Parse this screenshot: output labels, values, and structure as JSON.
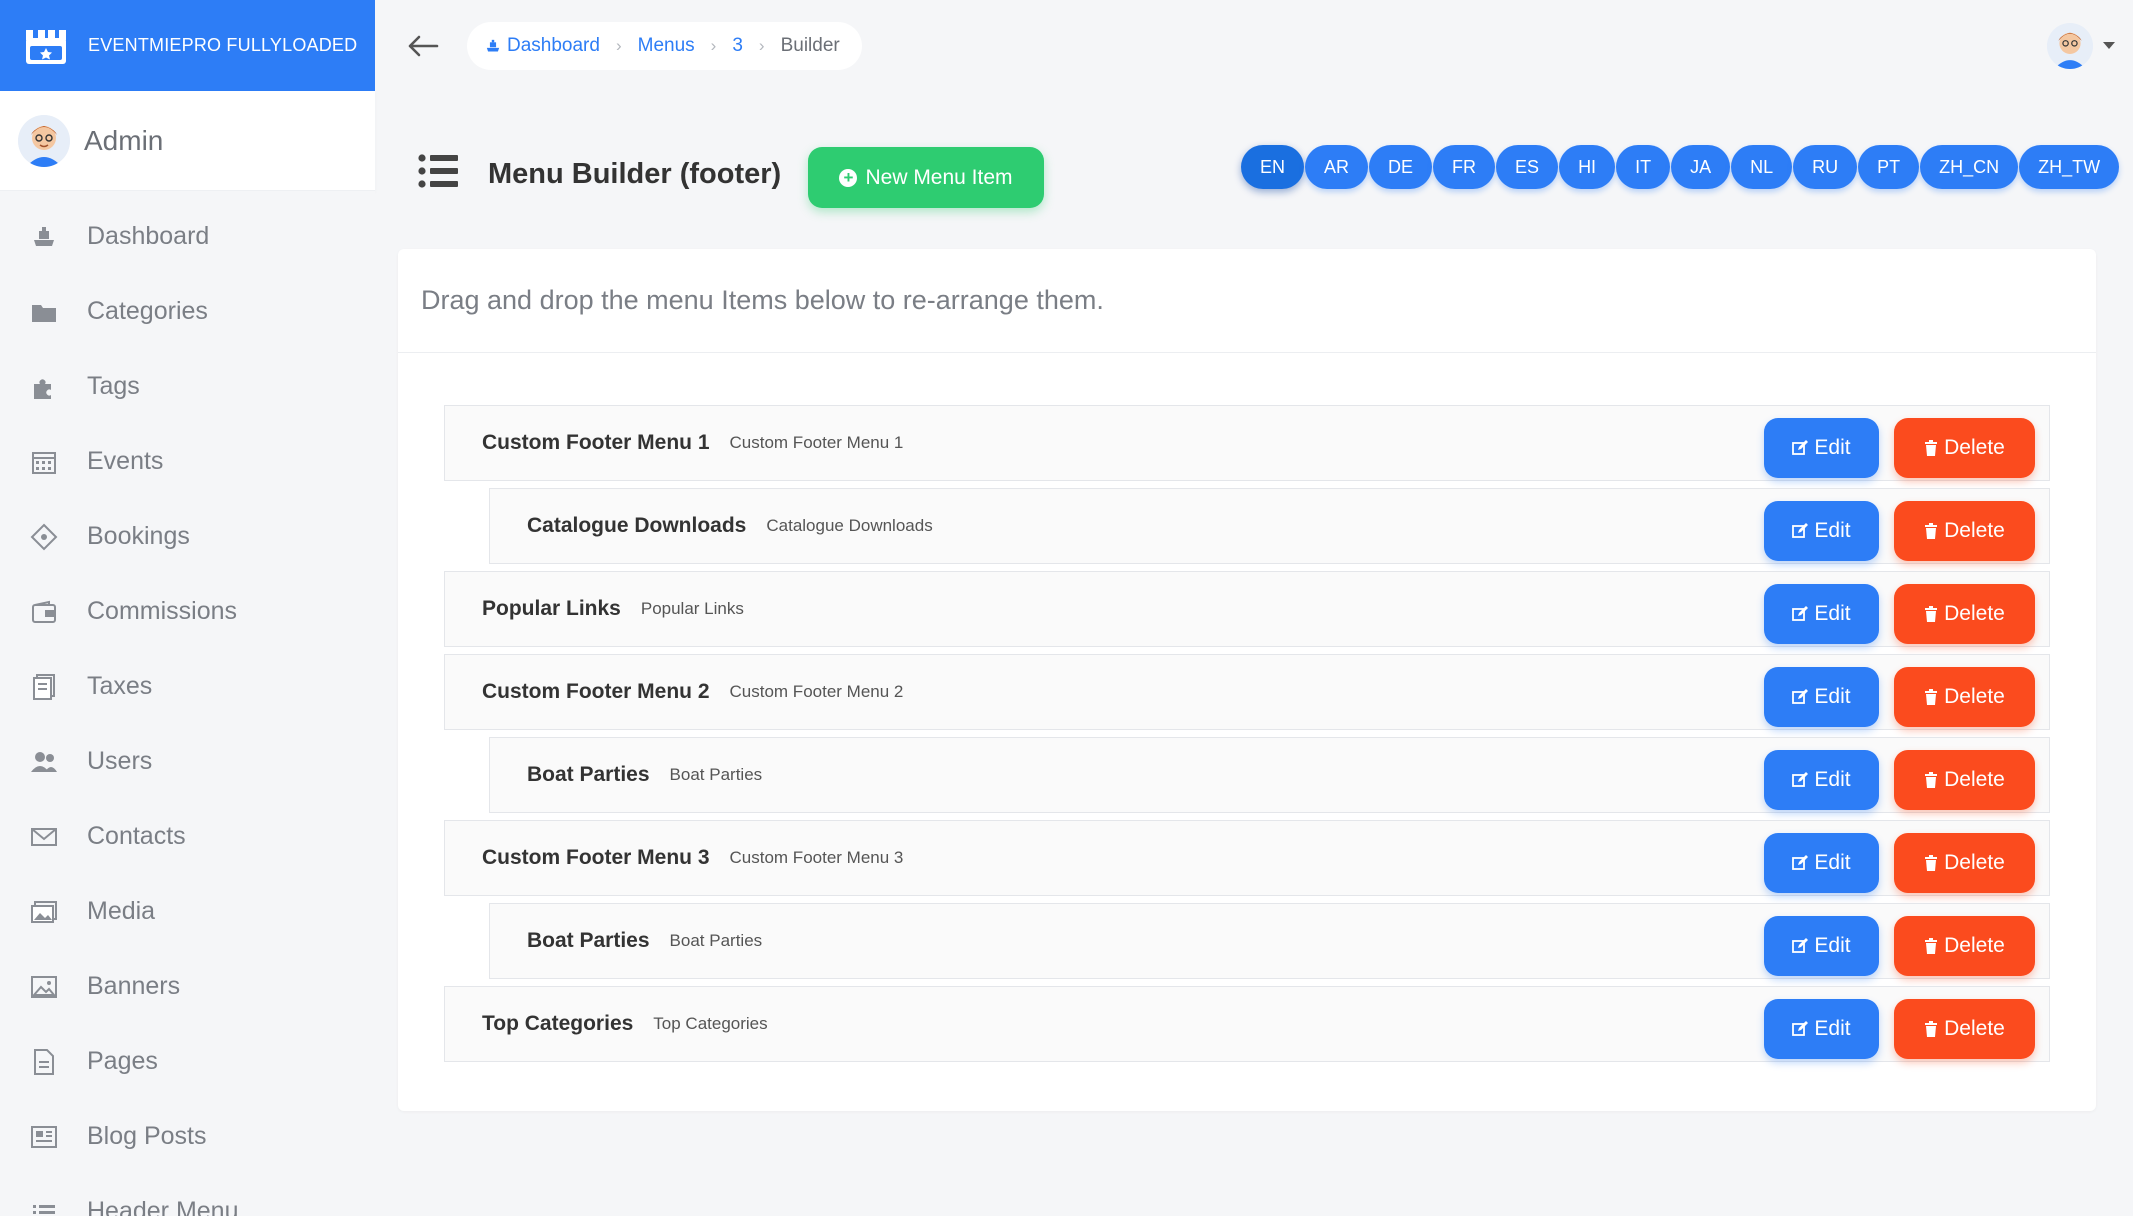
{
  "brand": {
    "name": "EVENTMIEPRO FULLYLOADED"
  },
  "admin": {
    "name": "Admin"
  },
  "sidebar": {
    "items": [
      {
        "label": "Dashboard",
        "icon": "dashboard-icon"
      },
      {
        "label": "Categories",
        "icon": "folder-icon"
      },
      {
        "label": "Tags",
        "icon": "puzzle-icon"
      },
      {
        "label": "Events",
        "icon": "calendar-icon"
      },
      {
        "label": "Bookings",
        "icon": "ticket-icon"
      },
      {
        "label": "Commissions",
        "icon": "wallet-icon"
      },
      {
        "label": "Taxes",
        "icon": "receipt-icon"
      },
      {
        "label": "Users",
        "icon": "users-icon"
      },
      {
        "label": "Contacts",
        "icon": "envelope-icon"
      },
      {
        "label": "Media",
        "icon": "images-icon"
      },
      {
        "label": "Banners",
        "icon": "image-icon"
      },
      {
        "label": "Pages",
        "icon": "file-icon"
      },
      {
        "label": "Blog Posts",
        "icon": "newspaper-icon"
      },
      {
        "label": "Header Menu",
        "icon": "list-icon"
      }
    ]
  },
  "breadcrumb": {
    "items": [
      "Dashboard",
      "Menus",
      "3",
      "Builder"
    ]
  },
  "header": {
    "title": "Menu Builder (footer)",
    "new_button": "New Menu Item"
  },
  "languages": [
    "EN",
    "AR",
    "DE",
    "FR",
    "ES",
    "HI",
    "IT",
    "JA",
    "NL",
    "RU",
    "PT",
    "ZH_CN",
    "ZH_TW"
  ],
  "active_language": "EN",
  "card": {
    "instruction": "Drag and drop the menu Items below to re-arrange them.",
    "edit_label": "Edit",
    "delete_label": "Delete"
  },
  "menu_items": [
    {
      "title": "Custom Footer Menu 1",
      "subtitle": "Custom Footer Menu 1",
      "child": false
    },
    {
      "title": "Catalogue Downloads",
      "subtitle": "Catalogue Downloads",
      "child": true
    },
    {
      "title": "Popular Links",
      "subtitle": "Popular Links",
      "child": false
    },
    {
      "title": "Custom Footer Menu 2",
      "subtitle": "Custom Footer Menu 2",
      "child": false
    },
    {
      "title": "Boat Parties",
      "subtitle": "Boat Parties",
      "child": true
    },
    {
      "title": "Custom Footer Menu 3",
      "subtitle": "Custom Footer Menu 3",
      "child": false
    },
    {
      "title": "Boat Parties",
      "subtitle": "Boat Parties",
      "child": true
    },
    {
      "title": "Top Categories",
      "subtitle": "Top Categories",
      "child": false
    }
  ],
  "colors": {
    "primary": "#2d7df6",
    "success": "#2ecc71",
    "danger": "#fb4b1e"
  }
}
